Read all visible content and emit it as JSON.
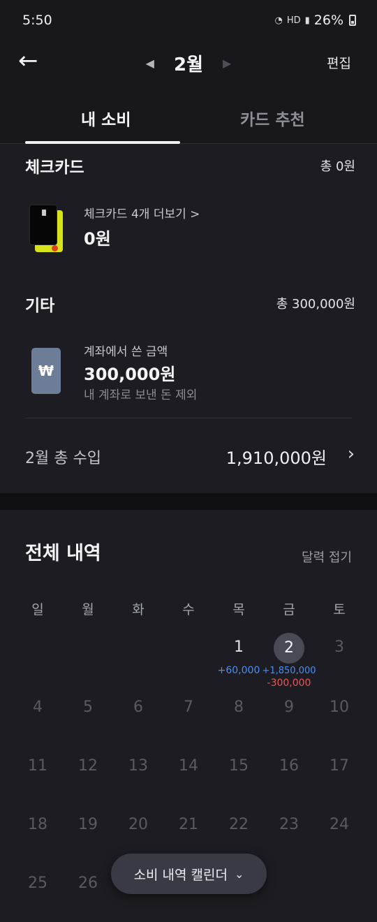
{
  "status": {
    "time": "5:50",
    "battery": "26%",
    "hd_label": "HD"
  },
  "header": {
    "back_icon": "arrow-left-icon",
    "month": "2월",
    "edit_label": "편집"
  },
  "tabs": [
    {
      "label": "내 소비",
      "active": true
    },
    {
      "label": "카드 추천",
      "active": false
    }
  ],
  "check_card": {
    "title": "체크카드",
    "total": "총 0원",
    "more_label": "체크카드 4개 더보기 >",
    "amount": "0원"
  },
  "other": {
    "title": "기타",
    "total": "총 300,000원",
    "label": "계좌에서 쓴 금액",
    "amount": "300,000원",
    "note": "내 계좌로 보낸 돈 제외",
    "icon_glyph": "₩"
  },
  "income": {
    "label": "2월 총 수입",
    "amount": "1,910,000원",
    "chevron": "›"
  },
  "history": {
    "title": "전체 내역",
    "collapse_label": "달력 접기"
  },
  "calendar": {
    "weekdays": [
      "일",
      "월",
      "화",
      "수",
      "목",
      "금",
      "토"
    ],
    "days": [
      "1",
      "2",
      "3",
      "4",
      "5",
      "6",
      "7",
      "8",
      "9",
      "10",
      "11",
      "12",
      "13",
      "14",
      "15",
      "16",
      "17",
      "18",
      "19",
      "20",
      "21",
      "22",
      "23",
      "24",
      "25",
      "26"
    ],
    "selected_day": "2",
    "day1_income": "+60,000",
    "day2_income": "+1,850,000",
    "day2_expense": "-300,000"
  },
  "fab": {
    "label": "소비 내역 캘린더"
  },
  "colors": {
    "income": "#4c8ef0",
    "expense": "#e85858",
    "background": "#17171c",
    "panel": "#1c1c22"
  }
}
